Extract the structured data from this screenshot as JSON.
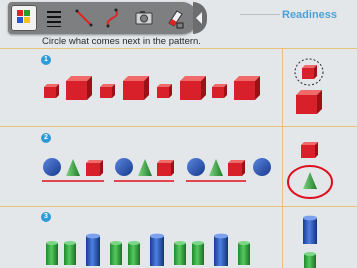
{
  "toolbar": {
    "tools": [
      {
        "name": "color-palette-icon",
        "active": true
      },
      {
        "name": "menu-lines-icon"
      },
      {
        "name": "line-tool-icon"
      },
      {
        "name": "curve-tool-icon"
      },
      {
        "name": "camera-icon"
      },
      {
        "name": "eraser-icon"
      }
    ],
    "collapse_icon": "chevron-left-icon"
  },
  "header": {
    "section_title": "Readiness"
  },
  "instruction": "Circle what comes next in the pattern.",
  "problems": [
    {
      "number": "1",
      "pattern": "small-cube, large-cube, small-cube, large-cube, small-cube, large-cube, small-cube, large-cube",
      "choices": [
        "small-cube (dashed circle)",
        "large-cube"
      ]
    },
    {
      "number": "2",
      "pattern": "sphere, cone, cube, sphere, cone, cube, sphere, cone, cube, sphere",
      "choices": [
        "cube",
        "cone (circled in red)"
      ]
    },
    {
      "number": "3",
      "pattern": "green cylinder, green cylinder, blue tall cylinder, ...",
      "choices": [
        "blue tall cylinder",
        "green cylinder"
      ]
    }
  ],
  "colors": {
    "red": "#d8202a",
    "blue": "#1f4fb0",
    "green": "#2ea83a",
    "annotation": "#e01020",
    "accent": "#2e9ad6"
  }
}
